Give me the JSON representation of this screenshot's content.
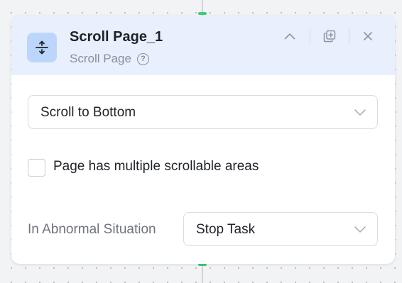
{
  "step": {
    "title": "Scroll Page_1",
    "subtitle": "Scroll Page",
    "icon": "vertical-arrows-icon",
    "help_icon_glyph": "?"
  },
  "scroll_mode": {
    "selected": "Scroll to Bottom"
  },
  "multiple_areas": {
    "label": "Page has multiple scrollable areas",
    "checked": false
  },
  "abnormal": {
    "label": "In Abnormal Situation",
    "selected": "Stop Task"
  },
  "colors": {
    "header_bg": "#e8f0fd",
    "icon_bg": "#bcd6fb",
    "connector_accent": "#3ccf7a"
  }
}
